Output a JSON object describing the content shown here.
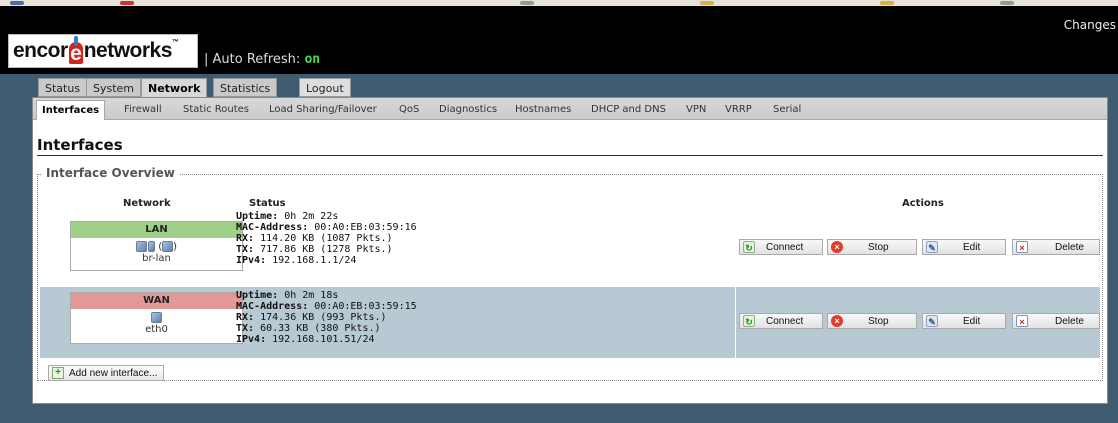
{
  "header": {
    "logo_text_1": "encor",
    "logo_text_e": "e",
    "logo_text_2": "networks",
    "logo_tm": "™",
    "auto_refresh_label": "| Auto Refresh:",
    "auto_refresh_value": "on",
    "changes_label": "Changes"
  },
  "tabs": [
    "Status",
    "System",
    "Network",
    "Statistics",
    "Logout"
  ],
  "subtabs": [
    "Interfaces",
    "Firewall",
    "Static Routes",
    "Load Sharing/Failover",
    "QoS",
    "Diagnostics",
    "Hostnames",
    "DHCP and DNS",
    "VPN",
    "VRRP",
    "Serial"
  ],
  "page_title": "Interfaces",
  "overview": {
    "legend": "Interface Overview",
    "col_network": "Network",
    "col_status": "Status",
    "col_actions": "Actions",
    "rows": [
      {
        "name": "LAN",
        "color": "#9fd08a",
        "icons": "(",
        "icons_close": ")",
        "device": "br-lan",
        "uptime_label": "Uptime:",
        "uptime": "0h 2m 22s",
        "mac_label": "MAC-Address:",
        "mac": "00:A0:EB:03:59:16",
        "rx_label": "RX:",
        "rx": "114.20 KB (1087 Pkts.)",
        "tx_label": "TX:",
        "tx": "717.86 KB (1278 Pkts.)",
        "ipv4_label": "IPv4:",
        "ipv4": "192.168.1.1/24"
      },
      {
        "name": "WAN",
        "color": "#e39898",
        "device": "eth0",
        "uptime_label": "Uptime:",
        "uptime": "0h 2m 18s",
        "mac_label": "MAC-Address:",
        "mac": "00:A0:EB:03:59:15",
        "rx_label": "RX:",
        "rx": "174.36 KB (993 Pkts.)",
        "tx_label": "TX:",
        "tx": "60.33 KB (380 Pkts.)",
        "ipv4_label": "IPv4:",
        "ipv4": "192.168.101.51/24"
      }
    ],
    "actions": [
      "Connect",
      "Stop",
      "Edit",
      "Delete"
    ],
    "add_label": "Add new interface..."
  }
}
